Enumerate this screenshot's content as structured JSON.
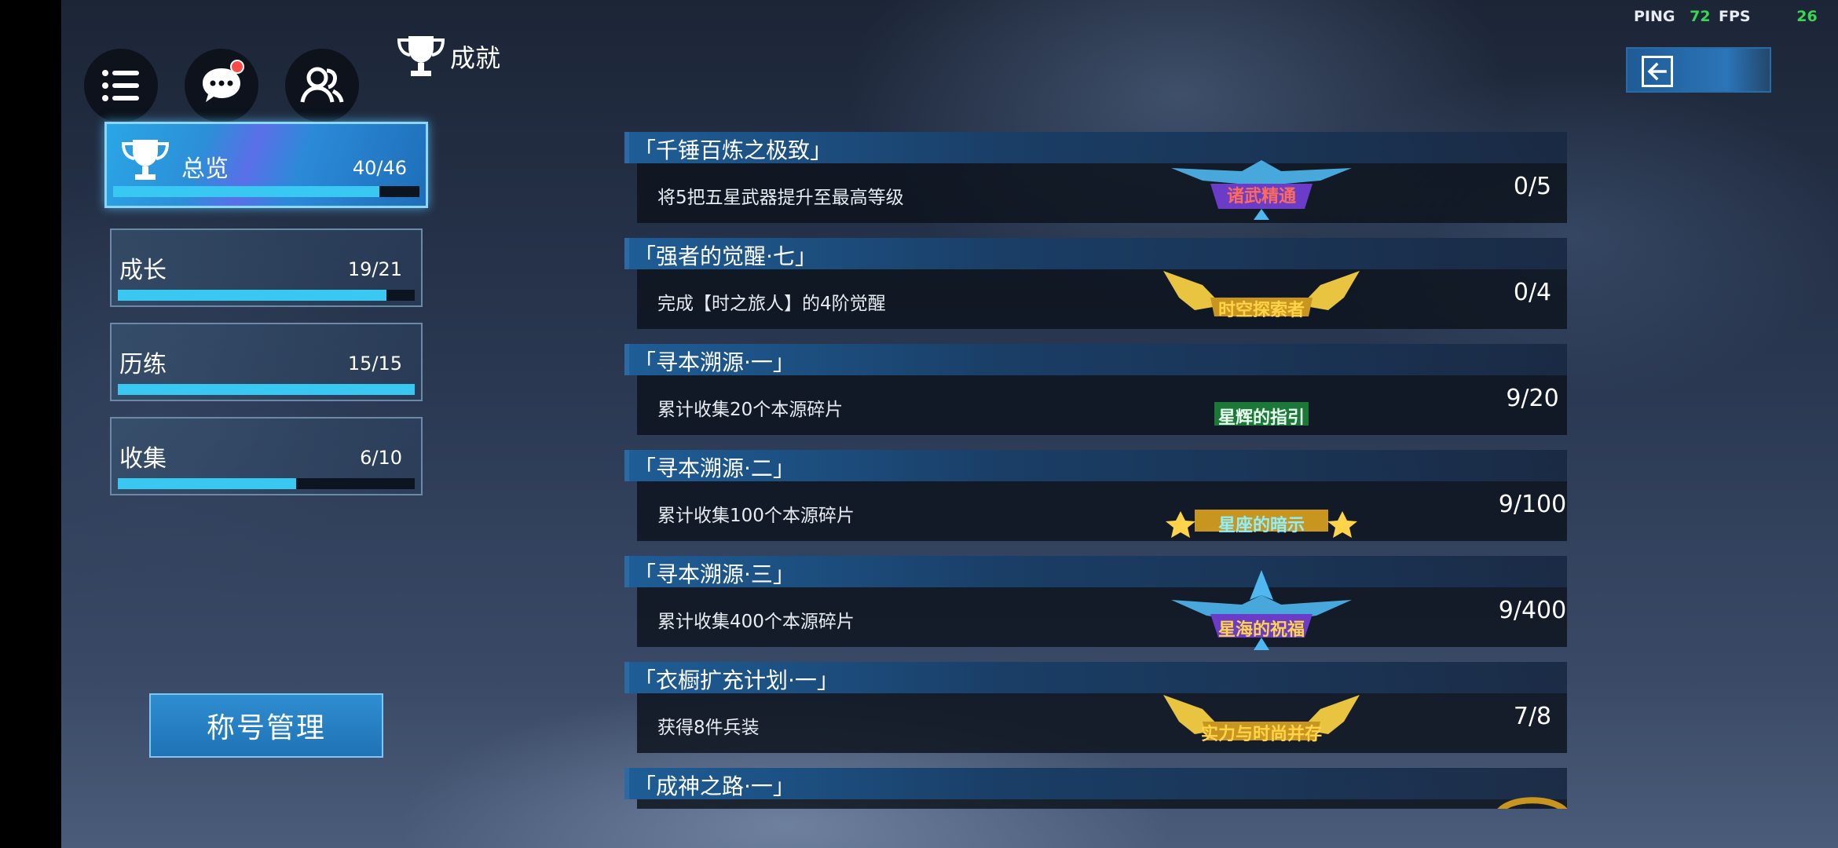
{
  "hud": {
    "ping_label": "PING",
    "ping_value": "72",
    "fps_label": "FPS",
    "fps_value": "26"
  },
  "header": {
    "title": "成就"
  },
  "categories": [
    {
      "label": "总览",
      "count": "40/46",
      "progress": 0.87
    },
    {
      "label": "成长",
      "count": "19/21",
      "progress": 0.905
    },
    {
      "label": "历练",
      "count": "15/15",
      "progress": 1.0
    },
    {
      "label": "收集",
      "count": "6/10",
      "progress": 0.6
    }
  ],
  "title_management_label": "称号管理",
  "achievements": [
    {
      "name": "「千锤百炼之极致」",
      "description": "将5把五星武器提升至最高等级",
      "badge": "诸武精通",
      "progress": "0/5"
    },
    {
      "name": "「强者的觉醒·七」",
      "description": "完成【时之旅人】的4阶觉醒",
      "badge": "时空探索者",
      "progress": "0/4"
    },
    {
      "name": "「寻本溯源·一」",
      "description": "累计收集20个本源碎片",
      "badge": "星辉的指引",
      "progress": "9/20"
    },
    {
      "name": "「寻本溯源·二」",
      "description": "累计收集100个本源碎片",
      "badge": "星座的暗示",
      "progress": "9/100"
    },
    {
      "name": "「寻本溯源·三」",
      "description": "累计收集400个本源碎片",
      "badge": "星海的祝福",
      "progress": "9/400"
    },
    {
      "name": "「衣橱扩充计划·一」",
      "description": "获得8件兵装",
      "badge": "实力与时尚并存",
      "progress": "7/8"
    },
    {
      "name": "「成神之路·一」"
    }
  ],
  "colors": {
    "accent": "#39c8f2",
    "ping_ok": "#39d651",
    "active_border": "#8ad6ff"
  },
  "icons": [
    "menu-icon",
    "chat-icon",
    "friends-icon",
    "trophy-icon",
    "back-arrow-icon"
  ]
}
